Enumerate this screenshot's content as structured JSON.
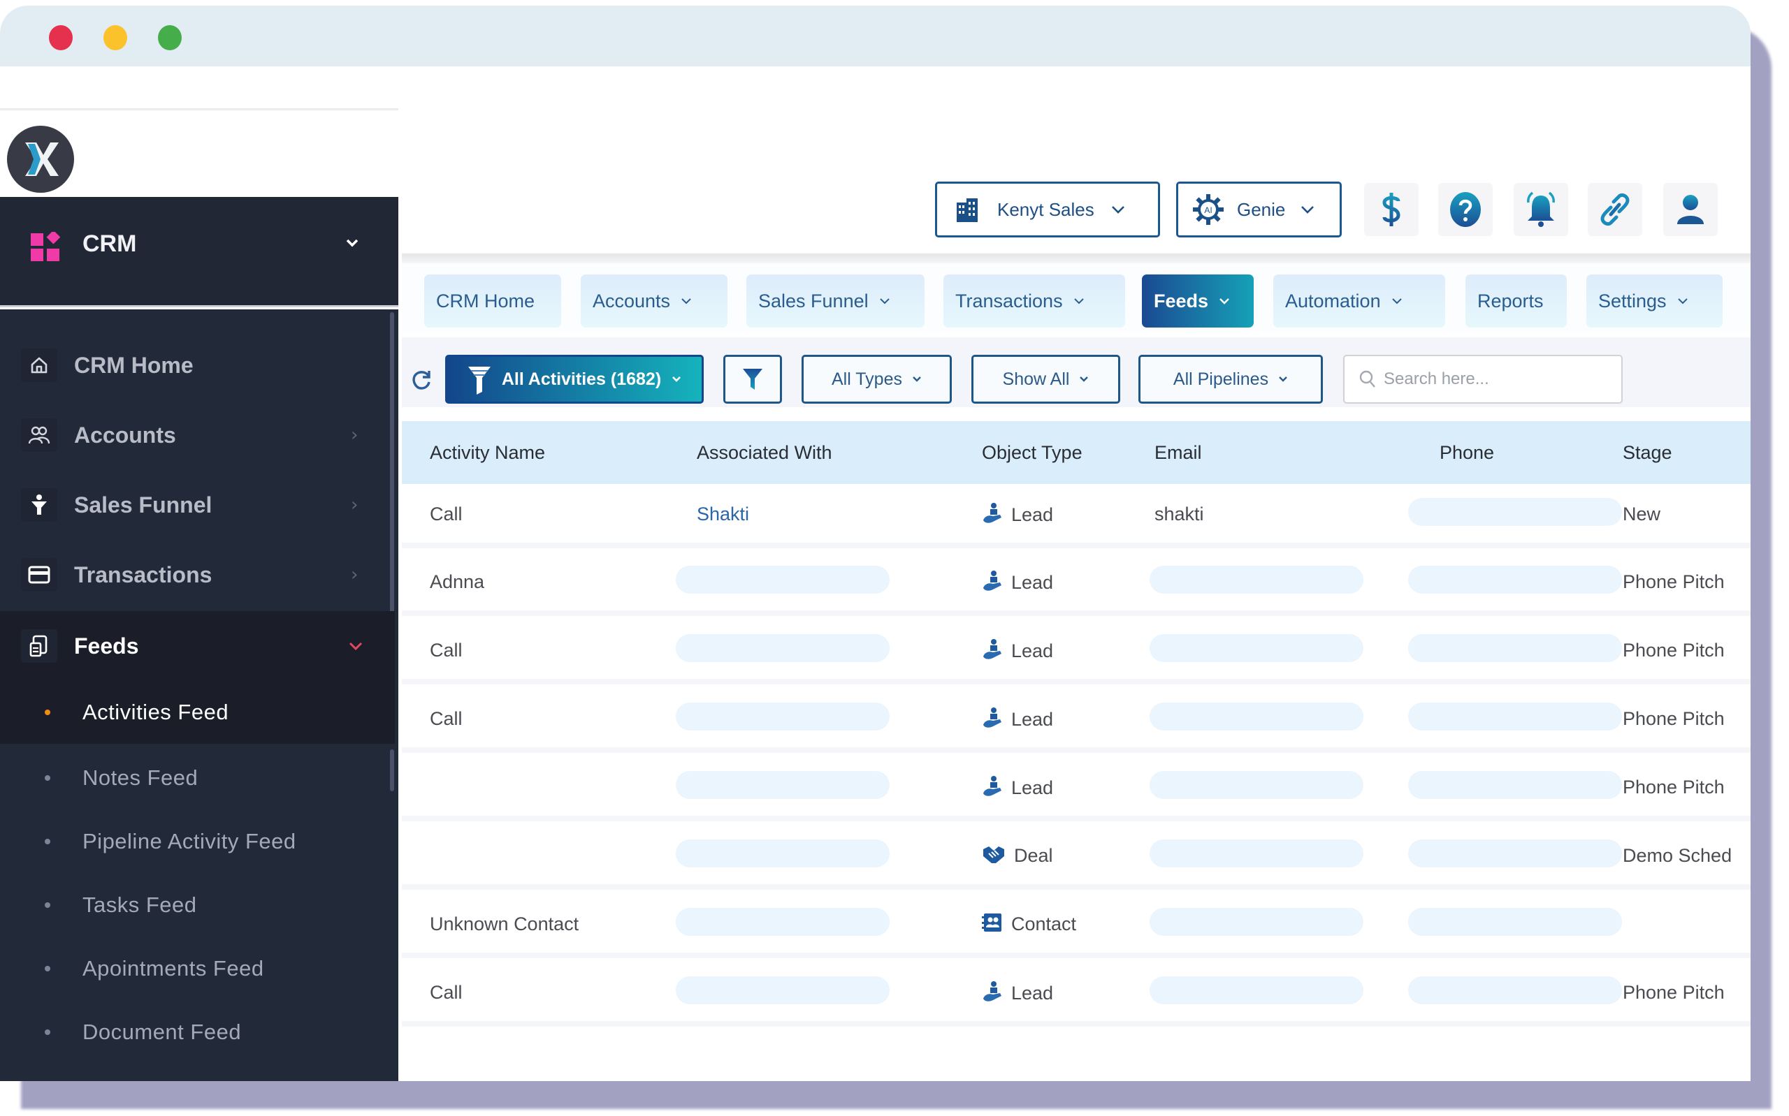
{
  "window": {
    "controls": [
      "close",
      "minimize",
      "maximize"
    ]
  },
  "sidebar": {
    "logo_icon": "x-logo-icon",
    "module": {
      "label": "CRM",
      "icon": "crm-grid-icon"
    },
    "items": [
      {
        "label": "CRM Home",
        "icon": "home-icon",
        "has_arrow": false
      },
      {
        "label": "Accounts",
        "icon": "users-icon",
        "has_arrow": true
      },
      {
        "label": "Sales Funnel",
        "icon": "funnel-icon",
        "has_arrow": true
      },
      {
        "label": "Transactions",
        "icon": "card-icon",
        "has_arrow": true
      },
      {
        "label": "Feeds",
        "icon": "feed-icon",
        "has_arrow": true,
        "expanded": true
      }
    ],
    "subitems": [
      {
        "label": "Activities Feed",
        "active": true
      },
      {
        "label": "Notes Feed"
      },
      {
        "label": "Pipeline Activity Feed"
      },
      {
        "label": "Tasks Feed"
      },
      {
        "label": "Apointments Feed"
      },
      {
        "label": "Document Feed"
      }
    ]
  },
  "topbar": {
    "company": "Kenyt Sales",
    "genie": "Genie",
    "genie_badge": "AI",
    "icons": [
      "dollar-icon",
      "help-icon",
      "bell-icon",
      "link-icon",
      "user-icon"
    ]
  },
  "nav": {
    "tabs": [
      {
        "label": "CRM Home",
        "dropdown": false
      },
      {
        "label": "Accounts",
        "dropdown": true
      },
      {
        "label": "Sales Funnel",
        "dropdown": true
      },
      {
        "label": "Transactions",
        "dropdown": true
      },
      {
        "label": "Feeds",
        "dropdown": true,
        "active": true
      },
      {
        "label": "Automation",
        "dropdown": true
      },
      {
        "label": "Reports",
        "dropdown": false
      },
      {
        "label": "Settings",
        "dropdown": true
      }
    ]
  },
  "filters": {
    "activities": "All Activities (1682)",
    "types": "All Types",
    "show": "Show All",
    "pipelines": "All Pipelines",
    "search_placeholder": "Search here..."
  },
  "table": {
    "columns": [
      "Activity Name",
      "Associated With",
      "Object Type",
      "Email",
      "Phone",
      "Stage"
    ],
    "rows": [
      {
        "activity": "Call",
        "associated": "Shakti",
        "object_type": "Lead",
        "email": "shakti",
        "phone": "",
        "stage": "New"
      },
      {
        "activity": "Adnna",
        "associated": "",
        "object_type": "Lead",
        "email": "",
        "phone": "",
        "stage": "Phone Pitch"
      },
      {
        "activity": "Call",
        "associated": "",
        "object_type": "Lead",
        "email": "",
        "phone": "",
        "stage": "Phone Pitch"
      },
      {
        "activity": "Call",
        "associated": "",
        "object_type": "Lead",
        "email": "",
        "phone": "",
        "stage": "Phone Pitch"
      },
      {
        "activity": "",
        "associated": "",
        "object_type": "Lead",
        "email": "",
        "phone": "",
        "stage": "Phone Pitch"
      },
      {
        "activity": "",
        "associated": "",
        "object_type": "Deal",
        "email": "",
        "phone": "",
        "stage": "Demo Sched"
      },
      {
        "activity": "Unknown Contact",
        "associated": "",
        "object_type": "Contact",
        "email": "",
        "phone": "",
        "stage": ""
      },
      {
        "activity": "Call",
        "associated": "",
        "object_type": "Lead",
        "email": "",
        "phone": "",
        "stage": "Phone Pitch"
      }
    ]
  },
  "colors": {
    "sidebar_bg": "#222a3a",
    "accent_blue": "#1b4a92",
    "accent_teal": "#16a1b7",
    "active_bullet": "#f08c16",
    "crm_icon": "#f03aa8",
    "table_header": "#d9edfb"
  }
}
